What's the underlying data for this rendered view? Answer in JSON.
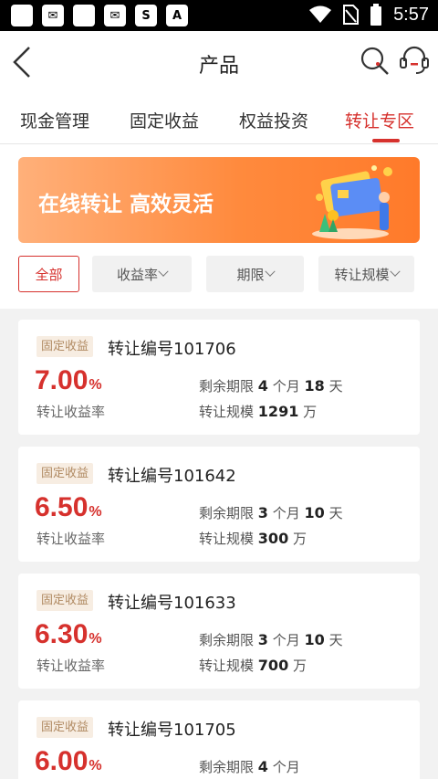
{
  "status": {
    "icons": [
      "square-icon",
      "mail-icon",
      "square-icon",
      "mail-icon",
      "s-app-icon",
      "a-app-icon"
    ],
    "time": "5:57"
  },
  "header": {
    "title": "产品"
  },
  "tabs": [
    {
      "label": "现金管理"
    },
    {
      "label": "固定收益"
    },
    {
      "label": "权益投资"
    },
    {
      "label": "转让专区"
    }
  ],
  "banner": {
    "text": "在线转让 高效灵活"
  },
  "filters": {
    "all": "全部",
    "rate": "收益率",
    "term": "期限",
    "scale": "转让规模"
  },
  "common": {
    "tag": "固定收益",
    "rate_label": "转让收益率",
    "remaining_label": "剩余期限",
    "scale_label": "转让规模",
    "month_unit": "个月",
    "day_unit": "天",
    "wan_unit": "万",
    "percent": "%"
  },
  "products": [
    {
      "title": "转让编号101706",
      "rate": "7.00",
      "months": "4",
      "days": "18",
      "scale": "1291"
    },
    {
      "title": "转让编号101642",
      "rate": "6.50",
      "months": "3",
      "days": "10",
      "scale": "300"
    },
    {
      "title": "转让编号101633",
      "rate": "6.30",
      "months": "3",
      "days": "10",
      "scale": "700"
    },
    {
      "title": "转让编号101705",
      "rate": "6.00",
      "months": "4",
      "days": "",
      "scale": ""
    }
  ],
  "colors": {
    "accent": "#d6312d",
    "banner": "#ff8a3d"
  }
}
